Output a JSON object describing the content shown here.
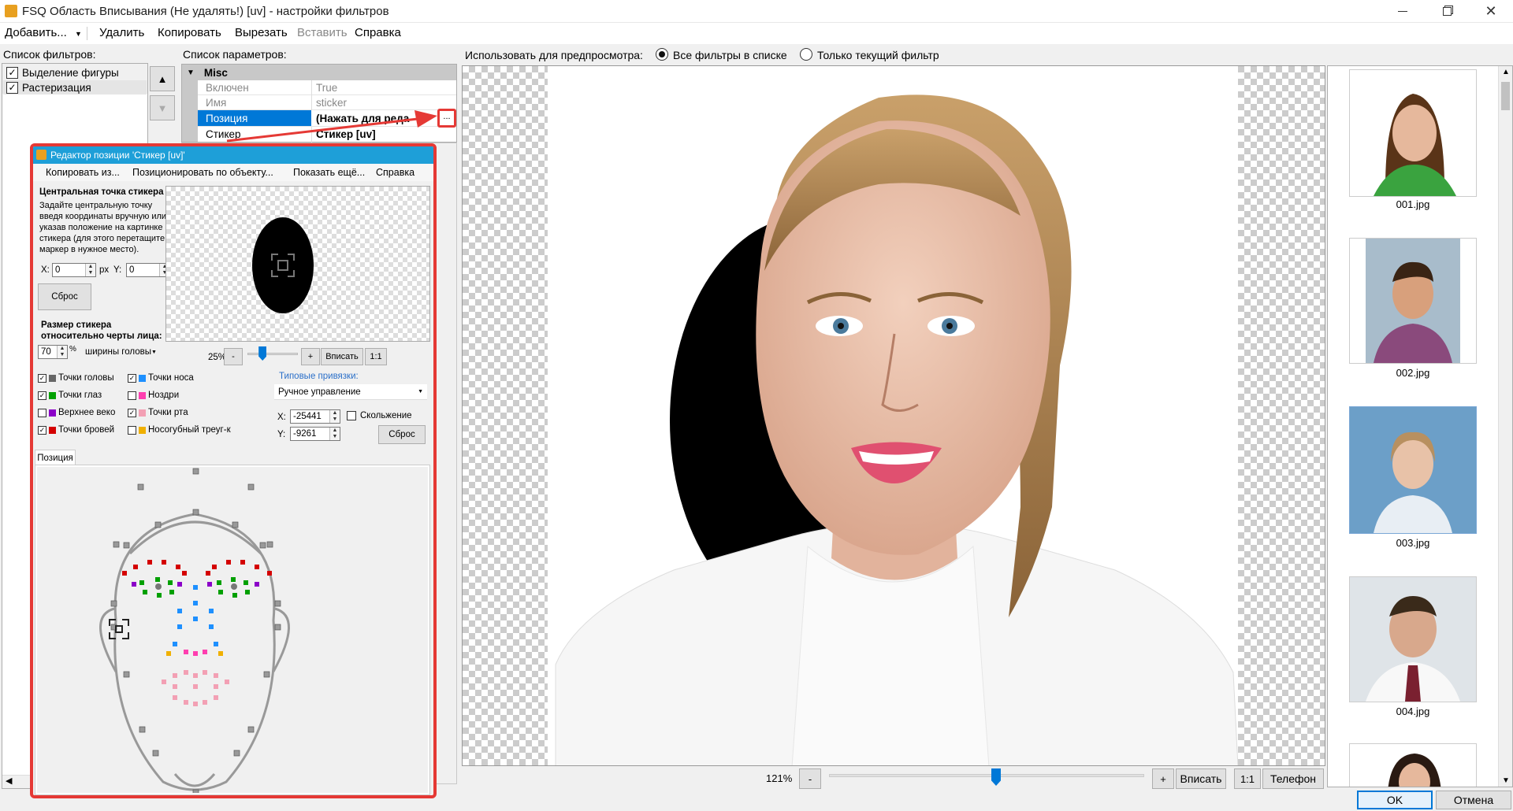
{
  "window": {
    "title": "FSQ Область Вписывания (Не удалять!) [uv] - настройки фильтров",
    "colors": {
      "accent": "#0078d7",
      "highlight_red": "#e53935",
      "selection": "#0078d7"
    }
  },
  "menu": {
    "add": "Добавить...",
    "delete": "Удалить",
    "copy": "Копировать",
    "cut": "Вырезать",
    "paste": "Вставить",
    "help": "Справка"
  },
  "filters": {
    "label": "Список фильтров:",
    "items": [
      {
        "label": "Выделение фигуры",
        "checked": true
      },
      {
        "label": "Растеризация",
        "checked": true
      }
    ]
  },
  "params": {
    "label": "Список параметров:",
    "category": "Misc",
    "rows": [
      {
        "name": "Включен",
        "value": "True"
      },
      {
        "name": "Имя",
        "value": "sticker"
      },
      {
        "name": "Позиция",
        "value": "(Нажать для реда"
      },
      {
        "name": "Стикер",
        "value": "Стикер [uv]"
      }
    ],
    "ellipsis": "..."
  },
  "preview": {
    "use_label": "Использовать для предпросмотра:",
    "opt_all": "Все фильтры в списке",
    "opt_current": "Только текущий фильтр",
    "zoom": "121%",
    "minus": "-",
    "plus": "+",
    "fit": "Вписать",
    "one": "1:1",
    "phone": "Телефон",
    "zoom_level": 0.53
  },
  "thumbnails": [
    "001.jpg",
    "002.jpg",
    "003.jpg",
    "004.jpg"
  ],
  "buttons": {
    "ok": "OK",
    "cancel": "Отмена"
  },
  "dialog": {
    "title": "Редактор позиции 'Стикер [uv]'",
    "menu": [
      "Копировать из...",
      "Позиционировать по объекту...",
      "Показать ещё...",
      "Справка"
    ],
    "center_title": "Центральная точка стикера",
    "center_desc": [
      "Задайте центральную точку",
      "введя координаты вручную или",
      "указав положение на картинке",
      "стикера (для этого перетащите",
      "маркер в нужное место)."
    ],
    "x_label": "X:",
    "x_val": "0",
    "y_label": "Y:",
    "y_val": "0",
    "px": "px",
    "reset": "Сброс",
    "size_title": [
      "Размер стикера",
      "относительно черты лица:"
    ],
    "size_val": "70",
    "percent": "%",
    "size_mode": "ширины головы",
    "zoom": "25%",
    "minus": "-",
    "plus": "+",
    "fit": "Вписать",
    "one": "1:1",
    "zoom_level": 0.3,
    "points": [
      {
        "label": "Точки головы",
        "checked": true,
        "color": "#666666"
      },
      {
        "label": "Точки носа",
        "checked": true,
        "color": "#1e90ff"
      },
      {
        "label": "Точки глаз",
        "checked": true,
        "color": "#00a000"
      },
      {
        "label": "Ноздри",
        "checked": false,
        "color": "#ff3fb0"
      },
      {
        "label": "Верхнее веко",
        "checked": false,
        "color": "#8b00c8"
      },
      {
        "label": "Точки рта",
        "checked": true,
        "color": "#f3a0b4"
      },
      {
        "label": "Точки бровей",
        "checked": true,
        "color": "#d40000"
      },
      {
        "label": "Носогубный треуг-к",
        "checked": false,
        "color": "#f0b000"
      }
    ],
    "anchor_label": "Типовые привязки:",
    "anchor_val": "Ручное управление",
    "ax_label": "X:",
    "ax_val": "-25441",
    "ay_label": "Y:",
    "ay_val": "-9261",
    "slide": "Скольжение",
    "areset": "Сброс",
    "tab": "Позиция"
  }
}
